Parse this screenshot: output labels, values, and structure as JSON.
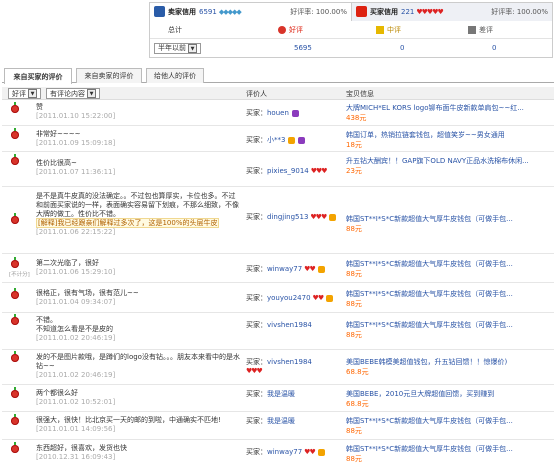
{
  "credit": {
    "seller_label": "卖家信用",
    "seller_score": "6591",
    "seller_rate_label": "好评率: 100.00%",
    "buyer_label": "买家信用",
    "buyer_score": "221",
    "buyer_rate_label": "好评率: 100.00%",
    "total_label": "总计",
    "period_select": "半年以前",
    "good_label": "好评",
    "mid_label": "中评",
    "bad_label": "差评",
    "good_count": "5695",
    "mid_count": "0",
    "bad_count": "0"
  },
  "tabs": [
    "来自买家的评价",
    "来自卖家的评价",
    "给他人的评价"
  ],
  "header": {
    "filter1": "好评",
    "filter2": "有评论内容",
    "col_buyer": "评价人",
    "col_item": "宝贝信息"
  },
  "rows": [
    {
      "comment": "赞",
      "date": "[2011.01.10 15:22:00]",
      "buyer": "houen",
      "badge": "purple",
      "item": "大牌MICH*EL KORS logo铆布面牛皮新款单肩包~~红...",
      "price": "438元"
    },
    {
      "comment": "非常好~~~~",
      "date": "[2011.01.09 15:09:18]",
      "buyer": "小**3",
      "badge": "purple",
      "item": "韩国订单，热销拉链套钱包，超值笑岁~~男女通用",
      "price": "18元"
    },
    {
      "comment": "性价比很高~",
      "date": "[2011.01.07 11:36:11]",
      "buyer": "pixies_9014",
      "badge": "none",
      "item": "升五钻大酬宾！！GAP旗下OLD NAVY正品水洗棉布休闲...",
      "price": "23元"
    },
    {
      "comment": "是不是真牛皮真的没法确定。。不过包也算厚实，卡位也多。不过和前面买家说的一样，表面确实容易留下划痕，不那么细致，不像大牌的做工。性价比不错。",
      "reply": "[解释]我已经跟亲们解释过多次了，这是100%的头层牛皮",
      "date": "[2011.01.06 22:15:22]",
      "buyer": "dingjing513",
      "badge": "orange",
      "item": "韩国ST**I*S*C新款超值大气厚牛皮钱包（可做手包...",
      "price": "88元"
    },
    {
      "comment": "第二次光临了，很好",
      "date": "[2011.01.06 15:29:10]",
      "buyer": "winway77",
      "badge": "orange",
      "mid": "[不计分]",
      "item": "韩国ST**I*S*C新款超值大气厚牛皮钱包（可做手包...",
      "price": "88元"
    },
    {
      "comment": "很格正，很有气场，很有范儿~~",
      "date": "[2011.01.04 09:34:07]",
      "buyer": "youyou2470",
      "badge": "orange",
      "item": "韩国ST**I*S*C新款超值大气厚牛皮钱包（可做手包...",
      "price": "88元"
    },
    {
      "comment": "不错。",
      "comment2": "不知道怎么看是不是皮的",
      "date": "[2011.01.02 20:46:19]",
      "buyer": "vivshen1984",
      "badge": "none",
      "item": "韩国ST**I*S*C新款超值大气厚牛皮钱包（可做手包...",
      "price": "88元"
    },
    {
      "comment": "发的不是图片款哦，是蹲们的logo没有钻。。。朋友本来看中的是水钻~~",
      "date": "[2011.01.02 20:46:19]",
      "buyer": "vivshen1984",
      "badge": "none",
      "item": "美国BEBE韩模美超值钱包，升五钻回馈！！惊爆价)",
      "price": "68.8元"
    },
    {
      "comment": "两个都很么好",
      "date": "[2011.01.02 10:52:01]",
      "buyer": "我是温暖",
      "badge": "none",
      "item": "美国BEBE，2010元旦大牌超值回馈，买到赚到",
      "price": "68.8元"
    },
    {
      "comment": "很强大，很快！比北京买一天的邮的到啦，中通确实不匹地!",
      "date": "[2011.01.01 14:09:56]",
      "buyer": "我是温暖",
      "badge": "none",
      "item": "韩国ST**I*S*C新款超值大气厚牛皮钱包（可做手包...",
      "price": "88元"
    },
    {
      "comment": "东西超好，很喜欢，发货也快",
      "date": "[2010.12.31 16:09:43]",
      "buyer": "winway77",
      "badge": "orange",
      "item": "韩国ST**I*S*C新款超值大气厚牛皮钱包（可做手包...",
      "price": "88元"
    }
  ],
  "common": {
    "buyer_prefix": "买家："
  },
  "colors": {
    "link": "#2953a6",
    "price": "#ff6600",
    "heart": "#dd2222"
  }
}
